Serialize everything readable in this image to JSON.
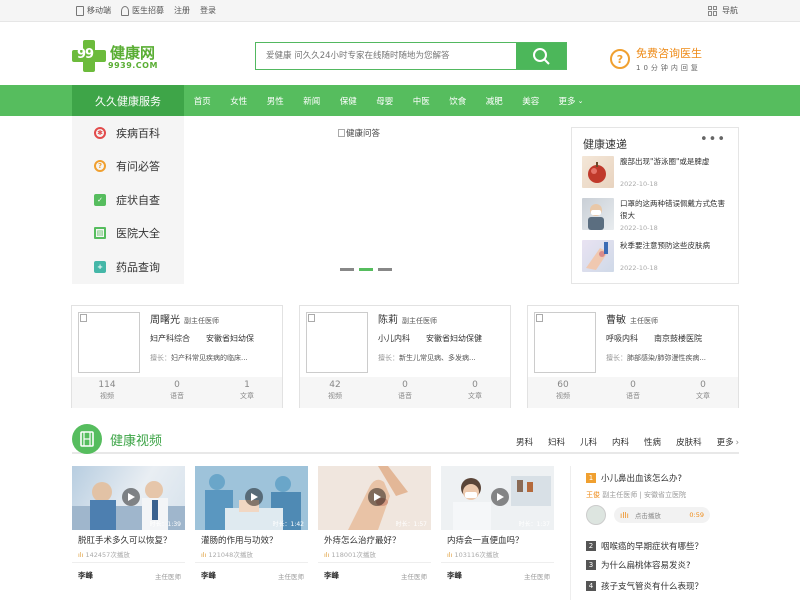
{
  "topbar": {
    "mobile": "移动端",
    "recruit": "医生招募",
    "register": "注册",
    "login": "登录",
    "nav_label": "导航"
  },
  "logo": {
    "number": "99",
    "name": "健康网",
    "domain": "9939.COM"
  },
  "search": {
    "placeholder": "爱健康 问久久24小时专家在线随时随地为您解答",
    "icon": "search-icon"
  },
  "consult": {
    "title": "免费咨询医生",
    "subtitle": "10分钟内回复",
    "icon": "question-icon"
  },
  "nav": {
    "service": "久久健康服务",
    "items": [
      "首页",
      "女性",
      "男性",
      "新闻",
      "保健",
      "母婴",
      "中医",
      "饮食",
      "减肥",
      "美容",
      "更多"
    ]
  },
  "sidemenu": [
    {
      "label": "疾病百科",
      "icon": "virus-icon",
      "color": "#e24b4b"
    },
    {
      "label": "有问必答",
      "icon": "question-icon",
      "color": "#f0a030"
    },
    {
      "label": "症状自查",
      "icon": "clipboard-icon",
      "color": "#56bd5e"
    },
    {
      "label": "医院大全",
      "icon": "building-icon",
      "color": "#56bd5e"
    },
    {
      "label": "药品查询",
      "icon": "medicine-icon",
      "color": "#45b7a8"
    }
  ],
  "banner": {
    "alt": "健康问答"
  },
  "news": {
    "title": "健康速递",
    "items": [
      {
        "title": "腹部出现\"游泳圈\"或是脾虚",
        "date": "2022-10-18"
      },
      {
        "title": "口罩的这两种错误佩戴方式危害很大",
        "date": "2022-10-18"
      },
      {
        "title": "秋季要注意预防这些皮肤病",
        "date": "2022-10-18"
      }
    ]
  },
  "doctors": [
    {
      "name": "周曙光",
      "title": "副主任医师",
      "dept": "妇产科综合",
      "hospital": "安徽省妇幼保",
      "specialty_label": "擅长：",
      "specialty": "妇产科常见疾病的临床...",
      "videos": "114",
      "audio": "0",
      "articles": "1"
    },
    {
      "name": "陈莉",
      "title": "副主任医师",
      "dept": "小儿内科",
      "hospital": "安徽省妇幼保健",
      "specialty_label": "擅长：",
      "specialty": "新生儿常见病、多发病...",
      "videos": "42",
      "audio": "0",
      "articles": "0"
    },
    {
      "name": "曹敏",
      "title": "主任医师",
      "dept": "呼吸内科",
      "hospital": "南京鼓楼医院",
      "specialty_label": "擅长：",
      "specialty": "肺部感染/肺弥漫性疾病...",
      "videos": "60",
      "audio": "0",
      "articles": "0"
    }
  ],
  "stat_labels": {
    "videos": "视频",
    "audio": "语音",
    "articles": "文章"
  },
  "video_section": {
    "title": "健康视频",
    "tabs": [
      "男科",
      "妇科",
      "儿科",
      "内科",
      "性病",
      "皮肤科",
      "更多"
    ]
  },
  "videos": [
    {
      "title": "脱肛手术多久可以恢复？",
      "plays": "142457次播放",
      "duration": "时长：1:39",
      "doctor": "李峰",
      "doctor_title": "主任医师"
    },
    {
      "title": "灌肠的作用与功效？",
      "plays": "121048次播放",
      "duration": "时长：1:42",
      "doctor": "李峰",
      "doctor_title": "主任医师"
    },
    {
      "title": "外痔怎么治疗最好？",
      "plays": "118001次播放",
      "duration": "时长：1:57",
      "doctor": "李峰",
      "doctor_title": "主任医师"
    },
    {
      "title": "内痔会一直便血吗？",
      "plays": "103116次播放",
      "duration": "时长：1:37",
      "doctor": "李峰",
      "doctor_title": "主任医师"
    }
  ],
  "qa": {
    "first": {
      "num": "1",
      "question": "小儿鼻出血该怎么办?",
      "doctor": "王俊",
      "doctor_title": "副主任医师",
      "hospital": "安徽省立医院",
      "play_label": "点击播放",
      "duration": "0:59"
    },
    "list": [
      {
        "num": "2",
        "question": "咽喉癌的早期症状有哪些？"
      },
      {
        "num": "3",
        "question": "为什么扁桃体容易发炎?"
      },
      {
        "num": "4",
        "question": "孩子支气管炎有什么表现？"
      }
    ]
  },
  "colors": {
    "brand_green": "#56bd5e",
    "dark_green": "#3ea548",
    "accent_orange": "#ee8a16"
  }
}
